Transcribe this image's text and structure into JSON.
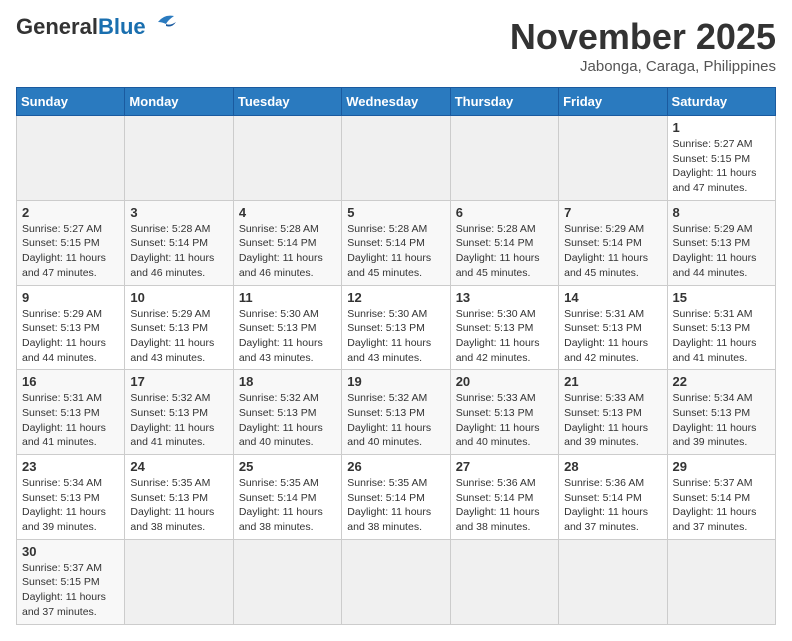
{
  "header": {
    "logo_general": "General",
    "logo_blue": "Blue",
    "month_title": "November 2025",
    "location": "Jabonga, Caraga, Philippines"
  },
  "weekdays": [
    "Sunday",
    "Monday",
    "Tuesday",
    "Wednesday",
    "Thursday",
    "Friday",
    "Saturday"
  ],
  "weeks": [
    [
      {
        "day": "",
        "empty": true
      },
      {
        "day": "",
        "empty": true
      },
      {
        "day": "",
        "empty": true
      },
      {
        "day": "",
        "empty": true
      },
      {
        "day": "",
        "empty": true
      },
      {
        "day": "",
        "empty": true
      },
      {
        "day": "1",
        "sunrise": "5:27 AM",
        "sunset": "5:15 PM",
        "daylight": "11 hours and 47 minutes."
      }
    ],
    [
      {
        "day": "2",
        "sunrise": "5:27 AM",
        "sunset": "5:15 PM",
        "daylight": "11 hours and 47 minutes."
      },
      {
        "day": "3",
        "sunrise": "5:28 AM",
        "sunset": "5:14 PM",
        "daylight": "11 hours and 46 minutes."
      },
      {
        "day": "4",
        "sunrise": "5:28 AM",
        "sunset": "5:14 PM",
        "daylight": "11 hours and 46 minutes."
      },
      {
        "day": "5",
        "sunrise": "5:28 AM",
        "sunset": "5:14 PM",
        "daylight": "11 hours and 45 minutes."
      },
      {
        "day": "6",
        "sunrise": "5:28 AM",
        "sunset": "5:14 PM",
        "daylight": "11 hours and 45 minutes."
      },
      {
        "day": "7",
        "sunrise": "5:29 AM",
        "sunset": "5:14 PM",
        "daylight": "11 hours and 45 minutes."
      },
      {
        "day": "8",
        "sunrise": "5:29 AM",
        "sunset": "5:13 PM",
        "daylight": "11 hours and 44 minutes."
      }
    ],
    [
      {
        "day": "9",
        "sunrise": "5:29 AM",
        "sunset": "5:13 PM",
        "daylight": "11 hours and 44 minutes."
      },
      {
        "day": "10",
        "sunrise": "5:29 AM",
        "sunset": "5:13 PM",
        "daylight": "11 hours and 43 minutes."
      },
      {
        "day": "11",
        "sunrise": "5:30 AM",
        "sunset": "5:13 PM",
        "daylight": "11 hours and 43 minutes."
      },
      {
        "day": "12",
        "sunrise": "5:30 AM",
        "sunset": "5:13 PM",
        "daylight": "11 hours and 43 minutes."
      },
      {
        "day": "13",
        "sunrise": "5:30 AM",
        "sunset": "5:13 PM",
        "daylight": "11 hours and 42 minutes."
      },
      {
        "day": "14",
        "sunrise": "5:31 AM",
        "sunset": "5:13 PM",
        "daylight": "11 hours and 42 minutes."
      },
      {
        "day": "15",
        "sunrise": "5:31 AM",
        "sunset": "5:13 PM",
        "daylight": "11 hours and 41 minutes."
      }
    ],
    [
      {
        "day": "16",
        "sunrise": "5:31 AM",
        "sunset": "5:13 PM",
        "daylight": "11 hours and 41 minutes."
      },
      {
        "day": "17",
        "sunrise": "5:32 AM",
        "sunset": "5:13 PM",
        "daylight": "11 hours and 41 minutes."
      },
      {
        "day": "18",
        "sunrise": "5:32 AM",
        "sunset": "5:13 PM",
        "daylight": "11 hours and 40 minutes."
      },
      {
        "day": "19",
        "sunrise": "5:32 AM",
        "sunset": "5:13 PM",
        "daylight": "11 hours and 40 minutes."
      },
      {
        "day": "20",
        "sunrise": "5:33 AM",
        "sunset": "5:13 PM",
        "daylight": "11 hours and 40 minutes."
      },
      {
        "day": "21",
        "sunrise": "5:33 AM",
        "sunset": "5:13 PM",
        "daylight": "11 hours and 39 minutes."
      },
      {
        "day": "22",
        "sunrise": "5:34 AM",
        "sunset": "5:13 PM",
        "daylight": "11 hours and 39 minutes."
      }
    ],
    [
      {
        "day": "23",
        "sunrise": "5:34 AM",
        "sunset": "5:13 PM",
        "daylight": "11 hours and 39 minutes."
      },
      {
        "day": "24",
        "sunrise": "5:35 AM",
        "sunset": "5:13 PM",
        "daylight": "11 hours and 38 minutes."
      },
      {
        "day": "25",
        "sunrise": "5:35 AM",
        "sunset": "5:14 PM",
        "daylight": "11 hours and 38 minutes."
      },
      {
        "day": "26",
        "sunrise": "5:35 AM",
        "sunset": "5:14 PM",
        "daylight": "11 hours and 38 minutes."
      },
      {
        "day": "27",
        "sunrise": "5:36 AM",
        "sunset": "5:14 PM",
        "daylight": "11 hours and 38 minutes."
      },
      {
        "day": "28",
        "sunrise": "5:36 AM",
        "sunset": "5:14 PM",
        "daylight": "11 hours and 37 minutes."
      },
      {
        "day": "29",
        "sunrise": "5:37 AM",
        "sunset": "5:14 PM",
        "daylight": "11 hours and 37 minutes."
      }
    ],
    [
      {
        "day": "30",
        "sunrise": "5:37 AM",
        "sunset": "5:15 PM",
        "daylight": "11 hours and 37 minutes."
      },
      {
        "day": "",
        "empty": true
      },
      {
        "day": "",
        "empty": true
      },
      {
        "day": "",
        "empty": true
      },
      {
        "day": "",
        "empty": true
      },
      {
        "day": "",
        "empty": true
      },
      {
        "day": "",
        "empty": true
      }
    ]
  ],
  "labels": {
    "sunrise_prefix": "Sunrise: ",
    "sunset_prefix": "Sunset: ",
    "daylight_prefix": "Daylight: "
  }
}
